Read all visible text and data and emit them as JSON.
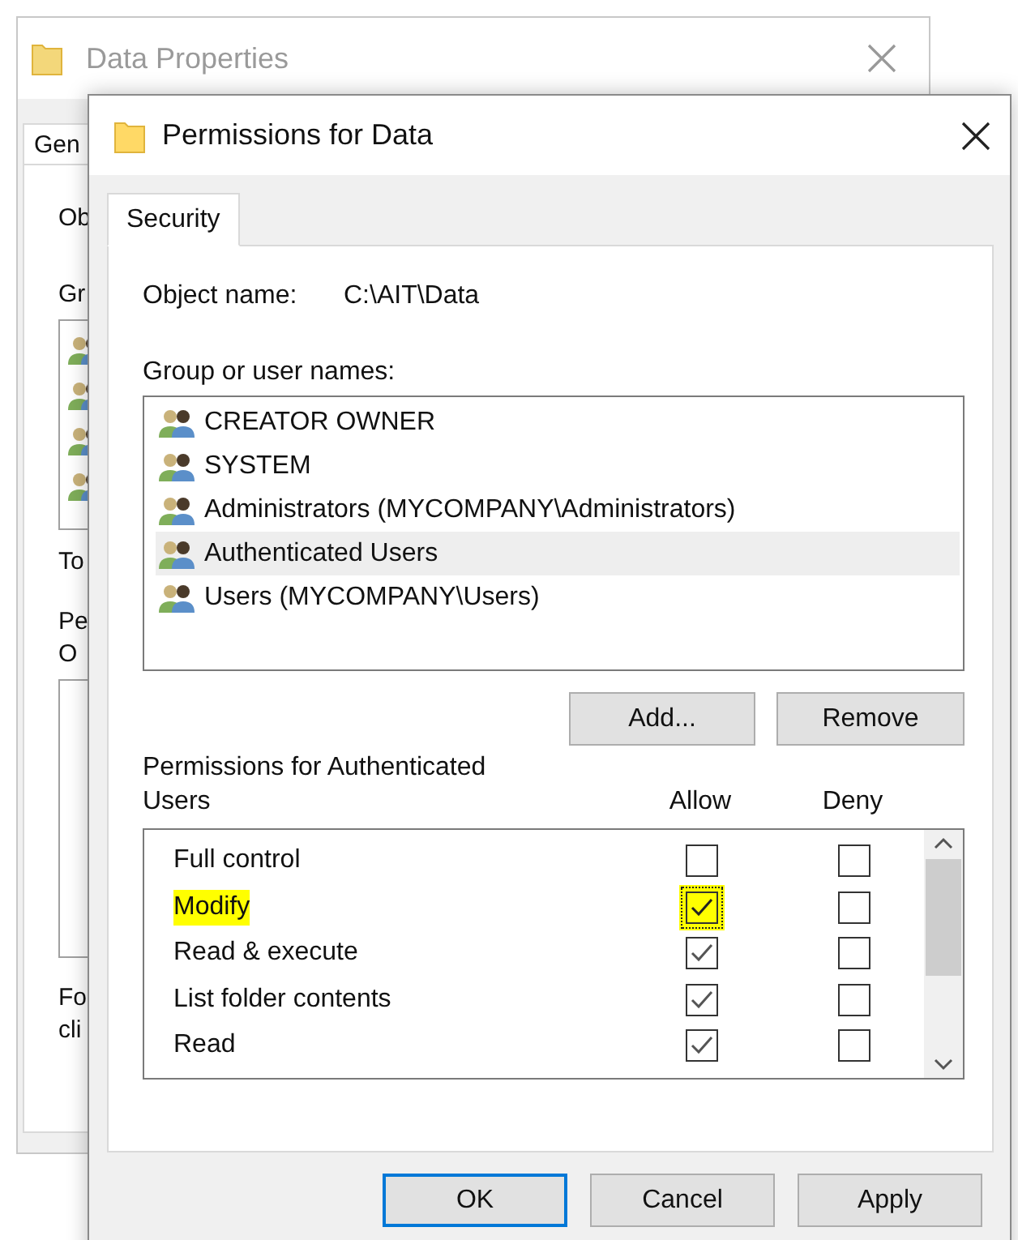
{
  "background_window": {
    "title": "Data Properties",
    "tabs": [
      {
        "label": "Gen",
        "selected": true
      }
    ],
    "object_label": "Ob",
    "group_label": "Gr",
    "total_label": "To",
    "permissions_label": [
      "Pe",
      "O"
    ],
    "footer_label": [
      "Fo",
      "cli"
    ]
  },
  "dialog": {
    "title": "Permissions for Data",
    "tabs": [
      {
        "label": "Security",
        "selected": true
      }
    ],
    "object_name_label": "Object name:",
    "object_name": "C:\\AIT\\Data",
    "group_label": "Group or user names:",
    "groups": [
      {
        "name": "CREATOR OWNER",
        "selected": false
      },
      {
        "name": "SYSTEM",
        "selected": false
      },
      {
        "name": "Administrators (MYCOMPANY\\Administrators)",
        "selected": false
      },
      {
        "name": "Authenticated Users",
        "selected": true
      },
      {
        "name": "Users (MYCOMPANY\\Users)",
        "selected": false
      }
    ],
    "group_buttons": [
      "Add...",
      "Remove"
    ],
    "permissions_label": "Permissions for Authenticated Users",
    "columns": [
      "Allow",
      "Deny"
    ],
    "permissions": [
      {
        "name": "Full control",
        "allow": false,
        "deny": false,
        "highlighted": false
      },
      {
        "name": "Modify",
        "allow": true,
        "deny": false,
        "highlighted": true
      },
      {
        "name": "Read & execute",
        "allow": true,
        "deny": false,
        "highlighted": false
      },
      {
        "name": "List folder contents",
        "allow": true,
        "deny": false,
        "highlighted": false
      },
      {
        "name": "Read",
        "allow": true,
        "deny": false,
        "highlighted": false
      }
    ],
    "buttons": [
      {
        "label": "OK",
        "default": true
      },
      {
        "label": "Cancel",
        "default": false
      },
      {
        "label": "Apply",
        "default": false
      }
    ]
  }
}
